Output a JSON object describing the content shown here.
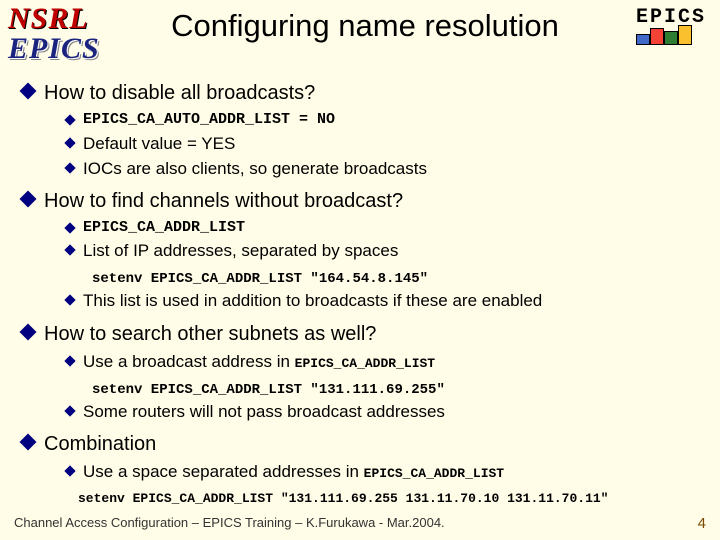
{
  "logos": {
    "nsrl": "NSRL",
    "epics": "EPICS"
  },
  "title": "Configuring name resolution",
  "badge": "EPICS",
  "sections": [
    {
      "heading": "How to disable all broadcasts?",
      "items": [
        {
          "type": "mono",
          "text": "EPICS_CA_AUTO_ADDR_LIST = NO"
        },
        {
          "type": "plain",
          "text": "Default value = YES"
        },
        {
          "type": "plain",
          "text": "IOCs are also clients, so generate broadcasts"
        }
      ]
    },
    {
      "heading": "How to find channels without broadcast?",
      "items": [
        {
          "type": "mono",
          "text": "EPICS_CA_ADDR_LIST"
        },
        {
          "type": "plain",
          "text": "List of IP addresses, separated by spaces"
        },
        {
          "type": "code",
          "text": "setenv EPICS_CA_ADDR_LIST \"164.54.8.145\""
        },
        {
          "type": "plain",
          "text": "This list is used in addition to broadcasts if these are enabled"
        }
      ]
    },
    {
      "heading": "How to search other subnets as well?",
      "items": [
        {
          "type": "mixed",
          "prefix": "Use a broadcast address in ",
          "mono": "EPICS_CA_ADDR_LIST"
        },
        {
          "type": "code",
          "text": "setenv EPICS_CA_ADDR_LIST \"131.111.69.255\""
        },
        {
          "type": "plain",
          "text": "Some routers will not pass broadcast addresses"
        }
      ]
    },
    {
      "heading": "Combination",
      "items": [
        {
          "type": "mixed",
          "prefix": "Use a space separated addresses in ",
          "mono": "EPICS_CA_ADDR_LIST"
        },
        {
          "type": "code-wide",
          "text": "setenv EPICS_CA_ADDR_LIST \"131.111.69.255 131.11.70.10 131.11.70.11\""
        }
      ]
    }
  ],
  "footer": {
    "text": "Channel Access Configuration – EPICS Training – K.Furukawa - Mar.2004.",
    "page": "4"
  }
}
